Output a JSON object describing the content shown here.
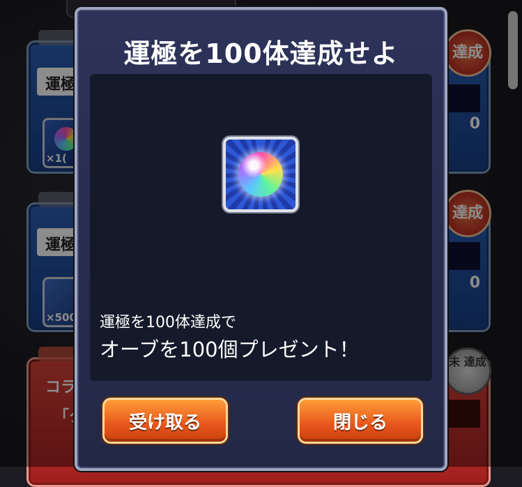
{
  "background_list": {
    "cards": [
      {
        "label": "運極",
        "qty": "×1(",
        "right_value": "0",
        "badge": "達成"
      },
      {
        "label": "運極",
        "qty": "×500",
        "right_value": "0",
        "badge": "達成"
      },
      {
        "label": "コラ",
        "qty": "",
        "right_value": "",
        "badge": "未\n達成"
      }
    ],
    "third_card_text": "「タ"
  },
  "modal": {
    "title": "運極を100体達成せよ",
    "description_line1": "運極を100体達成で",
    "description_line2": "オーブを100個プレゼント！",
    "reward_icon": "rainbow-orb",
    "buttons": {
      "receive": "受け取る",
      "close": "閉じる"
    }
  },
  "colors": {
    "modal_bg": "#2d3359",
    "button_orange": "#ff9d3a",
    "card_blue": "#2b5fb5",
    "card_red": "#d8413a"
  }
}
